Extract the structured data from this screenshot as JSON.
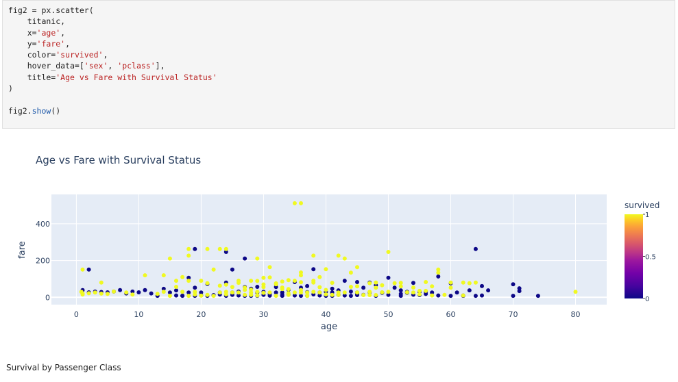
{
  "code": {
    "lines": [
      [
        {
          "t": "fig2 = px.scatter("
        }
      ],
      [
        {
          "t": "    titanic,"
        }
      ],
      [
        {
          "t": "    x="
        },
        {
          "t": "'age'",
          "c": "str"
        },
        {
          "t": ","
        }
      ],
      [
        {
          "t": "    y="
        },
        {
          "t": "'fare'",
          "c": "str"
        },
        {
          "t": ","
        }
      ],
      [
        {
          "t": "    color="
        },
        {
          "t": "'survived'",
          "c": "str"
        },
        {
          "t": ","
        }
      ],
      [
        {
          "t": "    hover_data=["
        },
        {
          "t": "'sex'",
          "c": "str"
        },
        {
          "t": ", "
        },
        {
          "t": "'pclass'",
          "c": "str"
        },
        {
          "t": "],"
        }
      ],
      [
        {
          "t": "    title="
        },
        {
          "t": "'Age vs Fare with Survival Status'",
          "c": "str"
        }
      ],
      [
        {
          "t": ")"
        }
      ],
      [
        {
          "t": ""
        }
      ],
      [
        {
          "t": "fig2."
        },
        {
          "t": "show",
          "c": "fn"
        },
        {
          "t": "()"
        }
      ]
    ]
  },
  "chart_data": {
    "type": "scatter",
    "title": "Age vs Fare with Survival Status",
    "xlabel": "age",
    "ylabel": "fare",
    "xlim": [
      -4,
      85
    ],
    "ylim": [
      -40,
      560
    ],
    "xticks": [
      0,
      10,
      20,
      30,
      40,
      50,
      60,
      70,
      80
    ],
    "yticks": [
      0,
      200,
      400
    ],
    "colorbar": {
      "title": "survived",
      "ticks": [
        0,
        0.5,
        1
      ],
      "ticklabels": [
        "0",
        "0.5",
        "1"
      ]
    },
    "colors": {
      "survived_0": "#0d0887",
      "survived_1": "#f0f921",
      "plot_bg": "#e5ecf6"
    },
    "series": [
      {
        "survived": 0,
        "points": [
          [
            2,
            151
          ],
          [
            19,
            263
          ],
          [
            24,
            247
          ],
          [
            25,
            151
          ],
          [
            27,
            211
          ],
          [
            35,
            83
          ],
          [
            38,
            153
          ],
          [
            43,
            90
          ],
          [
            45,
            83
          ],
          [
            50,
            106
          ],
          [
            54,
            78
          ],
          [
            60,
            76
          ],
          [
            64,
            263
          ],
          [
            66,
            38
          ],
          [
            70,
            71
          ],
          [
            71,
            49
          ],
          [
            71,
            34
          ],
          [
            74,
            8
          ],
          [
            65,
            61
          ],
          [
            63,
            38
          ],
          [
            58,
            113
          ],
          [
            56,
            30
          ],
          [
            55,
            12
          ],
          [
            53,
            25
          ],
          [
            52,
            38
          ],
          [
            51,
            52
          ],
          [
            49,
            24
          ],
          [
            48,
            66
          ],
          [
            47,
            80
          ],
          [
            46,
            52
          ],
          [
            44,
            31
          ],
          [
            42,
            38
          ],
          [
            41,
            47
          ],
          [
            40,
            30
          ],
          [
            39,
            26
          ],
          [
            37,
            61
          ],
          [
            36,
            52
          ],
          [
            34,
            41
          ],
          [
            33,
            26
          ],
          [
            32,
            56
          ],
          [
            31,
            18
          ],
          [
            30,
            30
          ],
          [
            29,
            57
          ],
          [
            28,
            47
          ],
          [
            27,
            56
          ],
          [
            26,
            31
          ],
          [
            25,
            26
          ],
          [
            24,
            80
          ],
          [
            23,
            15
          ],
          [
            22,
            12
          ],
          [
            21,
            73
          ],
          [
            20,
            26
          ],
          [
            19,
            52
          ],
          [
            18,
            106
          ],
          [
            17,
            9
          ],
          [
            16,
            38
          ],
          [
            15,
            26
          ],
          [
            14,
            46
          ],
          [
            13,
            8
          ],
          [
            12,
            21
          ],
          [
            11,
            39
          ],
          [
            10,
            27
          ],
          [
            9,
            31
          ],
          [
            8,
            21
          ],
          [
            7,
            39
          ],
          [
            6,
            31
          ],
          [
            5,
            27
          ],
          [
            4,
            29
          ],
          [
            3,
            31
          ],
          [
            2,
            27
          ],
          [
            1,
            39
          ],
          [
            45,
            12
          ],
          [
            28,
            8
          ],
          [
            33,
            8
          ],
          [
            36,
            8
          ],
          [
            40,
            8
          ],
          [
            44,
            8
          ],
          [
            48,
            8
          ],
          [
            52,
            8
          ],
          [
            60,
            8
          ],
          [
            62,
            8
          ],
          [
            64,
            8
          ],
          [
            70,
            8
          ],
          [
            61,
            26
          ],
          [
            57,
            26
          ],
          [
            55,
            30
          ],
          [
            47,
            27
          ],
          [
            43,
            10
          ],
          [
            39,
            10
          ],
          [
            35,
            10
          ],
          [
            31,
            9
          ],
          [
            27,
            8
          ],
          [
            24,
            8
          ],
          [
            21,
            8
          ],
          [
            19,
            8
          ],
          [
            17,
            8
          ],
          [
            16,
            10
          ],
          [
            20,
            10
          ],
          [
            22,
            10
          ],
          [
            26,
            10
          ],
          [
            30,
            13
          ],
          [
            34,
            14
          ],
          [
            38,
            16
          ],
          [
            42,
            13
          ],
          [
            46,
            13
          ],
          [
            50,
            13
          ],
          [
            54,
            14
          ],
          [
            58,
            10
          ],
          [
            62,
            10
          ],
          [
            65,
            10
          ],
          [
            18,
            26
          ],
          [
            23,
            26
          ],
          [
            29,
            26
          ],
          [
            32,
            26
          ],
          [
            37,
            28
          ],
          [
            41,
            26
          ],
          [
            45,
            26
          ],
          [
            49,
            26
          ],
          [
            53,
            30
          ],
          [
            25,
            13
          ],
          [
            29,
            8
          ],
          [
            33,
            13
          ],
          [
            37,
            8
          ],
          [
            41,
            8
          ],
          [
            45,
            18
          ],
          [
            52,
            18
          ],
          [
            56,
            18
          ]
        ]
      },
      {
        "survived": 1,
        "points": [
          [
            35,
            512
          ],
          [
            36,
            512
          ],
          [
            50,
            247
          ],
          [
            36,
            135
          ],
          [
            21,
            263
          ],
          [
            23,
            263
          ],
          [
            24,
            263
          ],
          [
            18,
            263
          ],
          [
            18,
            227
          ],
          [
            38,
            227
          ],
          [
            42,
            227
          ],
          [
            43,
            211
          ],
          [
            29,
            211
          ],
          [
            15,
            211
          ],
          [
            22,
            151
          ],
          [
            36,
            120
          ],
          [
            40,
            153
          ],
          [
            44,
            134
          ],
          [
            14,
            120
          ],
          [
            11,
            120
          ],
          [
            1,
            151
          ],
          [
            58,
            151
          ],
          [
            58,
            134
          ],
          [
            31,
            164
          ],
          [
            45,
            164
          ],
          [
            48,
            80
          ],
          [
            60,
            80
          ],
          [
            62,
            80
          ],
          [
            64,
            80
          ],
          [
            4,
            80
          ],
          [
            16,
            90
          ],
          [
            18,
            90
          ],
          [
            20,
            90
          ],
          [
            26,
            90
          ],
          [
            28,
            90
          ],
          [
            30,
            106
          ],
          [
            34,
            93
          ],
          [
            38,
            90
          ],
          [
            39,
            110
          ],
          [
            41,
            79
          ],
          [
            47,
            77
          ],
          [
            49,
            66
          ],
          [
            52,
            60
          ],
          [
            56,
            83
          ],
          [
            0.8,
            30
          ],
          [
            1,
            20
          ],
          [
            1,
            15
          ],
          [
            2,
            22
          ],
          [
            3,
            26
          ],
          [
            4,
            20
          ],
          [
            5,
            19
          ],
          [
            6,
            31
          ],
          [
            8,
            26
          ],
          [
            9,
            15
          ],
          [
            13,
            19
          ],
          [
            14,
            30
          ],
          [
            15,
            8
          ],
          [
            16,
            57
          ],
          [
            17,
            110
          ],
          [
            18,
            8
          ],
          [
            19,
            30
          ],
          [
            20,
            9
          ],
          [
            21,
            77
          ],
          [
            22,
            8
          ],
          [
            23,
            63
          ],
          [
            24,
            69
          ],
          [
            25,
            56
          ],
          [
            26,
            26
          ],
          [
            27,
            53
          ],
          [
            28,
            26
          ],
          [
            29,
            30
          ],
          [
            30,
            56
          ],
          [
            31,
            108
          ],
          [
            32,
            76
          ],
          [
            33,
            86
          ],
          [
            34,
            13
          ],
          [
            35,
            90
          ],
          [
            36,
            82
          ],
          [
            37,
            26
          ],
          [
            38,
            80
          ],
          [
            39,
            55
          ],
          [
            40,
            40
          ],
          [
            42,
            26
          ],
          [
            43,
            26
          ],
          [
            45,
            26
          ],
          [
            47,
            30
          ],
          [
            48,
            52
          ],
          [
            49,
            27
          ],
          [
            50,
            30
          ],
          [
            51,
            77
          ],
          [
            52,
            79
          ],
          [
            53,
            27
          ],
          [
            54,
            53
          ],
          [
            55,
            16
          ],
          [
            56,
            35
          ],
          [
            57,
            10
          ],
          [
            59,
            13
          ],
          [
            60,
            52
          ],
          [
            62,
            10
          ],
          [
            63,
            77
          ],
          [
            80,
            30
          ],
          [
            17,
            30
          ],
          [
            19,
            15
          ],
          [
            21,
            13
          ],
          [
            23,
            26
          ],
          [
            24,
            16
          ],
          [
            25,
            26
          ],
          [
            27,
            13
          ],
          [
            28,
            13
          ],
          [
            29,
            10
          ],
          [
            30,
            24
          ],
          [
            31,
            26
          ],
          [
            32,
            8
          ],
          [
            33,
            53
          ],
          [
            34,
            23
          ],
          [
            35,
            26
          ],
          [
            36,
            26
          ],
          [
            37,
            8
          ],
          [
            38,
            30
          ],
          [
            39,
            26
          ],
          [
            40,
            16
          ],
          [
            41,
            13
          ],
          [
            42,
            13
          ],
          [
            44,
            57
          ],
          [
            45,
            60
          ],
          [
            46,
            12
          ],
          [
            47,
            12
          ],
          [
            48,
            12
          ],
          [
            54,
            26
          ],
          [
            55,
            35
          ],
          [
            57,
            60
          ],
          [
            24,
            30
          ],
          [
            26,
            79
          ],
          [
            28,
            42
          ],
          [
            30,
            70
          ],
          [
            32,
            71
          ],
          [
            34,
            45
          ],
          [
            36,
            39
          ],
          [
            27,
            40
          ],
          [
            29,
            89
          ],
          [
            33,
            45
          ]
        ]
      }
    ]
  },
  "next_section": {
    "title": "Survival by Passenger Class"
  }
}
